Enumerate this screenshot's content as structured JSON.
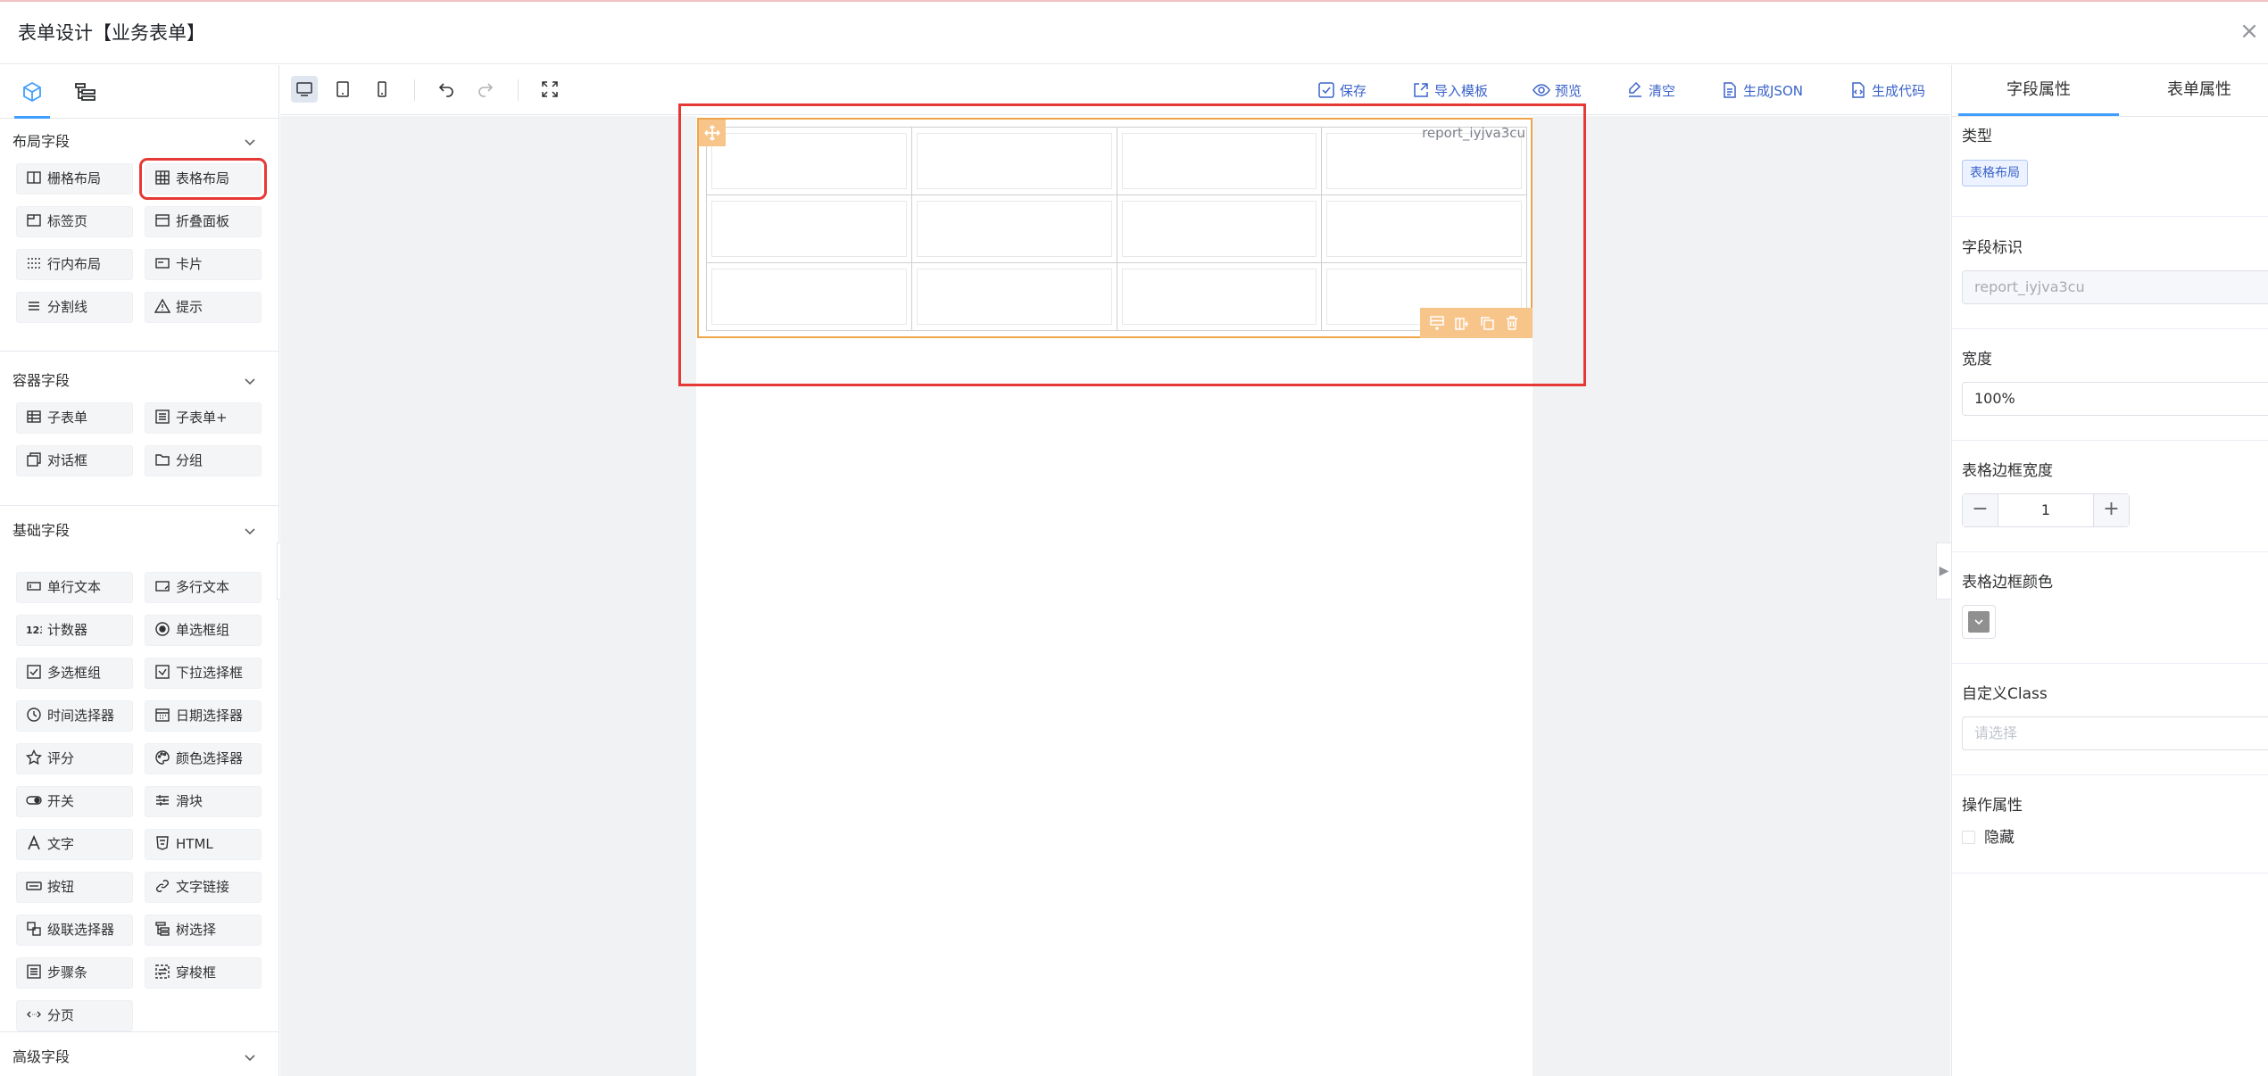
{
  "dialog": {
    "title": "表单设计【业务表单】",
    "close": "×"
  },
  "left_panel": {
    "tabs": [
      {
        "icon": "cube-icon",
        "label": ""
      },
      {
        "icon": "outline-tree-icon",
        "label": ""
      }
    ],
    "sections": [
      {
        "title": "布局字段",
        "items": [
          {
            "label": "栅格布局",
            "icon": "columns-icon"
          },
          {
            "label": "表格布局",
            "icon": "table-grid-icon"
          },
          {
            "label": "标签页",
            "icon": "tab-icon"
          },
          {
            "label": "折叠面板",
            "icon": "collapse-panel-icon"
          },
          {
            "label": "行内布局",
            "icon": "inline-layout-icon"
          },
          {
            "label": "卡片",
            "icon": "card-icon"
          },
          {
            "label": "分割线",
            "icon": "divider-icon"
          },
          {
            "label": "提示",
            "icon": "warning-icon"
          }
        ]
      },
      {
        "title": "容器字段",
        "items": [
          {
            "label": "子表单",
            "icon": "subform-icon"
          },
          {
            "label": "子表单+",
            "icon": "subform-plus-icon"
          },
          {
            "label": "对话框",
            "icon": "dialog-icon"
          },
          {
            "label": "分组",
            "icon": "folder-icon"
          }
        ]
      },
      {
        "title": "基础字段",
        "items": [
          {
            "label": "单行文本",
            "icon": "input-icon"
          },
          {
            "label": "多行文本",
            "icon": "textarea-icon"
          },
          {
            "label": "计数器",
            "icon": "counter-icon"
          },
          {
            "label": "单选框组",
            "icon": "radio-icon"
          },
          {
            "label": "多选框组",
            "icon": "checkbox-icon"
          },
          {
            "label": "下拉选择框",
            "icon": "select-icon"
          },
          {
            "label": "时间选择器",
            "icon": "clock-icon"
          },
          {
            "label": "日期选择器",
            "icon": "calendar-icon"
          },
          {
            "label": "评分",
            "icon": "star-icon"
          },
          {
            "label": "颜色选择器",
            "icon": "palette-icon"
          },
          {
            "label": "开关",
            "icon": "switch-icon"
          },
          {
            "label": "滑块",
            "icon": "slider-icon"
          },
          {
            "label": "文字",
            "icon": "text-icon"
          },
          {
            "label": "HTML",
            "icon": "html-icon"
          },
          {
            "label": "按钮",
            "icon": "button-icon"
          },
          {
            "label": "文字链接",
            "icon": "link-icon"
          },
          {
            "label": "级联选择器",
            "icon": "cascader-icon"
          },
          {
            "label": "树选择",
            "icon": "tree-icon"
          },
          {
            "label": "步骤条",
            "icon": "steps-icon"
          },
          {
            "label": "穿梭框",
            "icon": "transfer-icon"
          },
          {
            "label": "分页",
            "icon": "pagination-icon"
          }
        ]
      },
      {
        "title": "高级字段",
        "items": []
      }
    ]
  },
  "toolbar": {
    "actions": [
      {
        "label": "保存",
        "icon": "save-icon"
      },
      {
        "label": "导入模板",
        "icon": "import-icon"
      },
      {
        "label": "预览",
        "icon": "eye-icon"
      },
      {
        "label": "清空",
        "icon": "clear-icon"
      },
      {
        "label": "生成JSON",
        "icon": "json-icon"
      },
      {
        "label": "生成代码",
        "icon": "code-icon"
      }
    ]
  },
  "canvas": {
    "widget_id": "report_iyjva3cu",
    "rows": 3,
    "cols": 4
  },
  "right_panel": {
    "tabs": [
      "字段属性",
      "表单属性"
    ],
    "type_label": "类型",
    "type_value": "表格布局",
    "field_id_label": "字段标识",
    "field_id_value": "report_iyjva3cu",
    "width_label": "宽度",
    "width_value": "100%",
    "border_width_label": "表格边框宽度",
    "border_width_value": "1",
    "border_color_label": "表格边框颜色",
    "border_color_value": "#909090",
    "custom_class_label": "自定义Class",
    "custom_class_placeholder": "请选择",
    "ops_label": "操作属性",
    "hidden_label": "隐藏"
  },
  "colors": {
    "accent": "#409eff",
    "action_text": "#3a62c9",
    "widget_border": "#f0a54a",
    "selection_highlight": "#e53935"
  }
}
